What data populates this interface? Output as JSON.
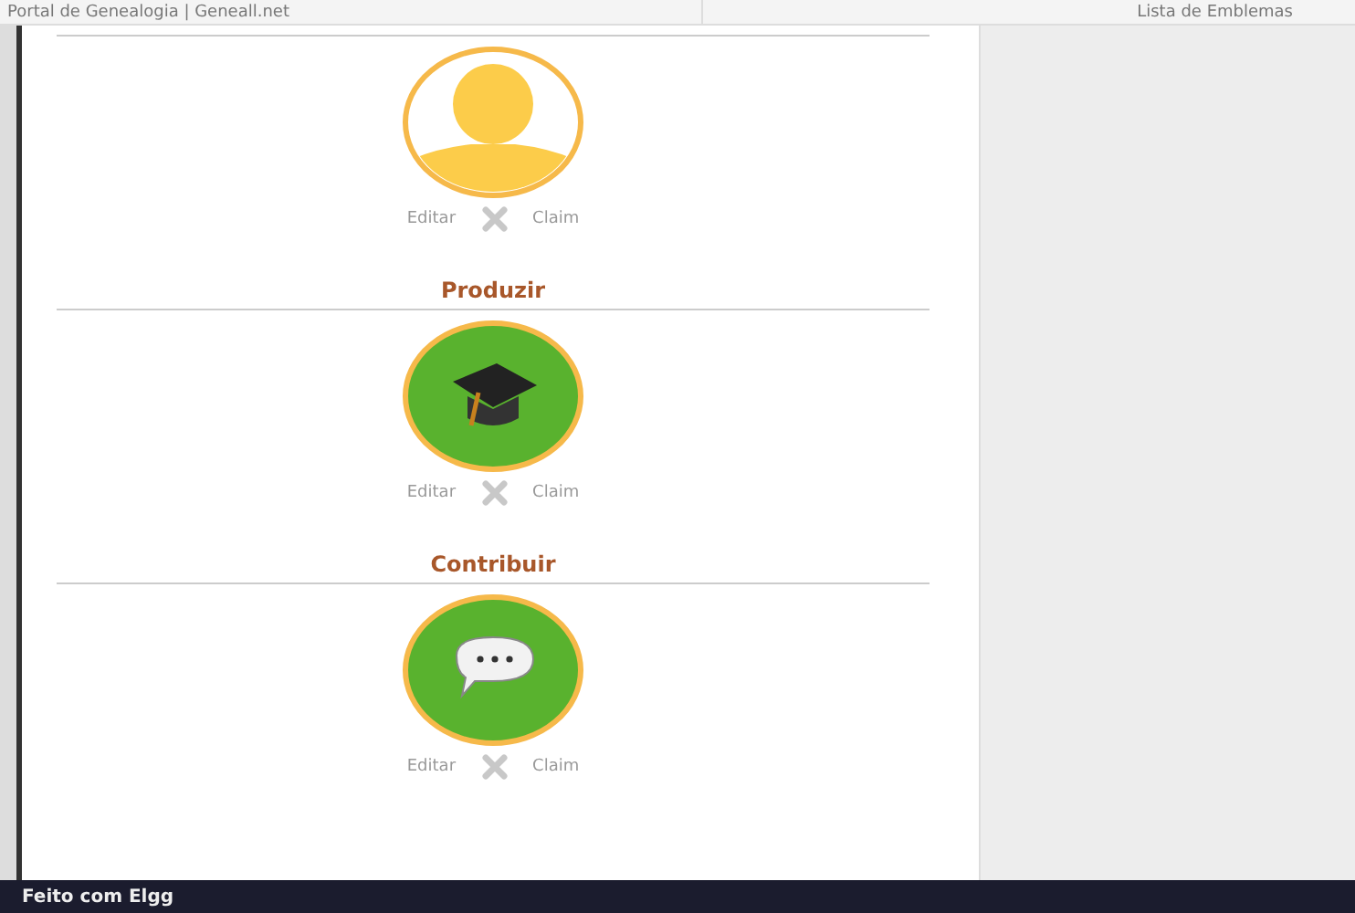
{
  "top_bar": {
    "site_title": "Portal de Genealogia | Geneall.net",
    "page_title": "Lista de Emblemas"
  },
  "badges": [
    {
      "kind": "person",
      "actions": [
        "Editar",
        "Claim"
      ]
    },
    {
      "title": "Produzir",
      "kind": "cap",
      "actions": [
        "Editar",
        "Claim"
      ]
    },
    {
      "title": "Contribuir",
      "kind": "chat",
      "actions": [
        "Editar",
        "Claim"
      ]
    }
  ],
  "footer": {
    "text": "Feito com Elgg"
  }
}
